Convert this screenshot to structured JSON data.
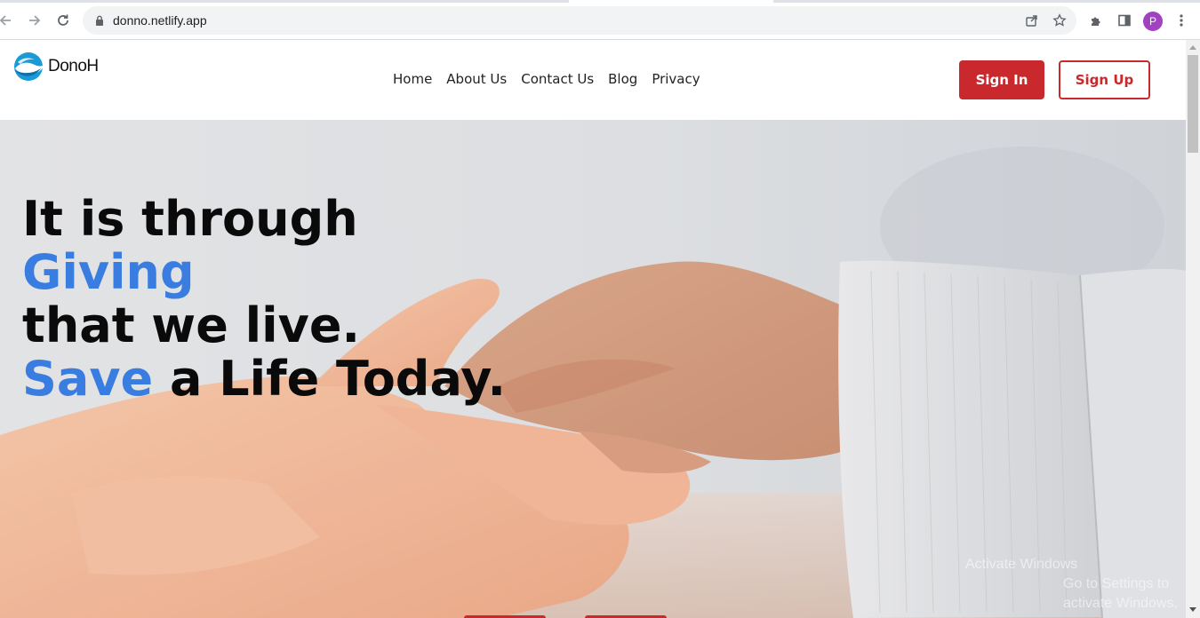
{
  "browser": {
    "url": "donno.netlify.app",
    "profile_initial": "P",
    "icons": [
      "back-icon",
      "forward-icon",
      "reload-icon",
      "lock-icon",
      "share-icon",
      "star-icon",
      "extensions-icon",
      "side-panel-icon",
      "menu-icon"
    ]
  },
  "site": {
    "logo_text": "DonoH",
    "nav": {
      "home": "Home",
      "about": "About Us",
      "contact": "Contact Us",
      "blog": "Blog",
      "privacy": "Privacy"
    },
    "sign_in": "Sign In",
    "sign_up": "Sign Up"
  },
  "hero": {
    "line1": "It is through",
    "line2_accent": "Giving",
    "line3": "that we live.",
    "line4_accent": "Save",
    "line4_rest": " a Life Today."
  },
  "watermark": {
    "line1": "Activate Windows",
    "line2": "Go to Settings to activate Windows."
  },
  "colors": {
    "brand_red": "#c9282d",
    "accent_blue": "#3a7de0",
    "avatar_purple": "#a142c1"
  }
}
